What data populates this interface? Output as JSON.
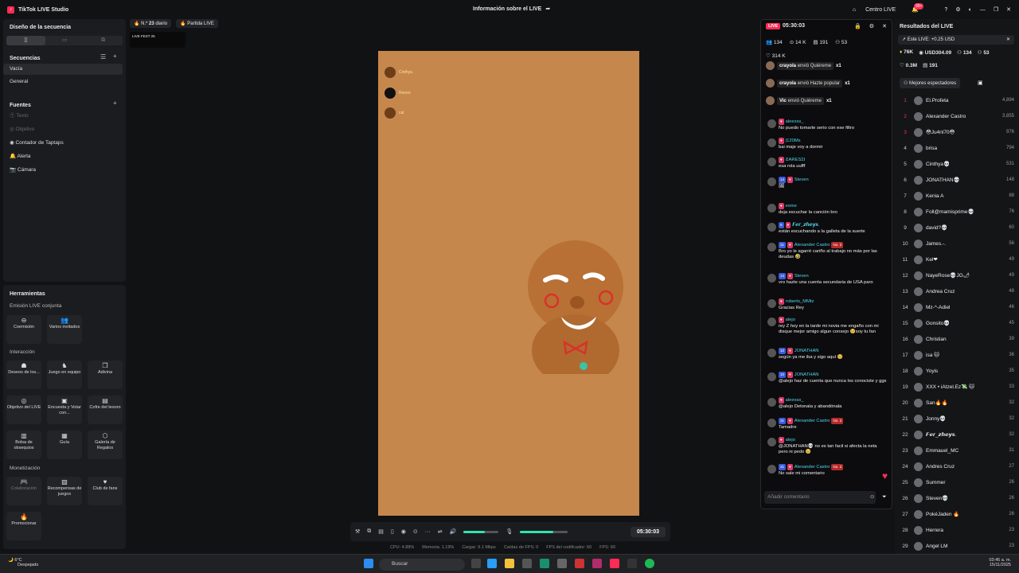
{
  "window": {
    "app_title": "TikTok LIVE Studio",
    "center_title": "Información sobre el LIVE",
    "centro_live": "Centro LIVE",
    "notif_badge": "99+"
  },
  "left": {
    "design_title": "Diseño de la secuencia",
    "sequences_title": "Secuencias",
    "sequences": [
      "Vacía",
      "General"
    ],
    "sources_title": "Fuentes",
    "sources": [
      "Texto",
      "Objetivo",
      "Contador de Taptaps",
      "Alerta",
      "Cámara"
    ],
    "tools_title": "Herramientas",
    "groups": {
      "joint": "Emisión LIVE conjunta",
      "interaction": "Interacción",
      "monetization": "Monetización"
    },
    "tools_joint": [
      "Coemisión",
      "Varios invitados"
    ],
    "tools_interaction": [
      "Deseos de los...",
      "Juego en equipo",
      "Adivina",
      "Objetivo del LIVE",
      "Encuesta y Votar con...",
      "Cofre del tesoro",
      "Bolsa de obsequios",
      "Guía",
      "Galería de Regalos"
    ],
    "tools_monet": [
      "Colaboración",
      "Recompensas de juegos",
      "Club de fans",
      "Promocionar"
    ]
  },
  "preview": {
    "rank_pill": "N.º",
    "rank_num": "23",
    "rank_suffix": "diario",
    "match_pill": "Partida LIVE",
    "livefest": "LIVE FEST 25",
    "gifts": [
      {
        "name": "Cinthya"
      },
      {
        "name": "Renee"
      },
      {
        "name": "cal"
      }
    ]
  },
  "controls": {
    "timer": "05:30:03",
    "volume": 0.6,
    "mic": 0.7
  },
  "status": {
    "cpu": "CPU: 4.88%",
    "mem": "Memoria: 1.19%",
    "load": "Cargar: 9.1 Mbps",
    "drops": "Caídas de FPS: 0",
    "enc": "FPS del codificador: 60",
    "fps": "FPS: 60"
  },
  "chat": {
    "live": "LIVE",
    "time": "05:30:03",
    "viewers": "134",
    "k": "14 K",
    "c1": "191",
    "c2": "53",
    "likes": "314 K",
    "pinned": [
      {
        "user": "crayola",
        "action": "envió Quiéreme",
        "count": "x1"
      },
      {
        "user": "crayola",
        "action": "envió Hazte popular",
        "count": "x1"
      },
      {
        "user": "Vic",
        "action": "envió Quiéreme",
        "count": "x1"
      }
    ],
    "messages": [
      {
        "name": "aleexss_",
        "text": "No puedo tomarte serio con ese filtro"
      },
      {
        "name": "|120Ms",
        "text": "bai maje voy a dormir"
      },
      {
        "name": "ƧARESΣI",
        "text": "esa rola uufff"
      },
      {
        "lvl": "14",
        "name": "Steven",
        "text": "🖼"
      },
      {
        "name": "esme",
        "text": "deja escuchar la canción bro"
      },
      {
        "lvl": "9",
        "name": "𝙁𝙚𝙧_𝙯𝙝𝙚𝙮𝙨.",
        "text": "están escuchando a la galleta de la suerte"
      },
      {
        "lvl": "31",
        "name": "Alexander Castro",
        "no2": "No. 2",
        "text": "Bro yo le agarré cariño al trabajo no más por las deudas 🤣"
      },
      {
        "lvl": "14",
        "name": "Steven",
        "text": "vro hazte una cuenta secundaria de USA paro"
      },
      {
        "name": "roberto_MMtz",
        "text": "Gracias Rey"
      },
      {
        "name": "alejo",
        "text": "rey Z hoy en la tarde mi novia me engaño con mi disque mejor amigo algun consejo 🥺soy tu fan"
      },
      {
        "lvl": "10",
        "name": "JONATHAN",
        "text": "según ya me iba y sigo aquí 🥺"
      },
      {
        "lvl": "10",
        "name": "JONATHAN",
        "text": "@alejo haz de cuenta que nunca los conociste y ggs"
      },
      {
        "name": "aleexss_",
        "text": "@alejo Detonala y abandónala"
      },
      {
        "lvl": "31",
        "name": "Alexander Castro",
        "no2": "No. 2",
        "text": "Tamadre"
      },
      {
        "name": "alejo",
        "text": "@JONATHAN💀 no es tan facil si afecta la neta pero ni pedo 🥺"
      },
      {
        "lvl": "31",
        "name": "Alexander Castro",
        "no2": "No. 2",
        "text": "No sale mi comentario"
      }
    ],
    "input_placeholder": "Añadir comentario"
  },
  "results": {
    "title": "Resultados del LIVE",
    "estimate": "Este LIVE: +0.25 USD",
    "s1": "76K",
    "s2": "USD304.09",
    "s3": "134",
    "s4": "53",
    "s5": "0.3M",
    "s6": "191",
    "tab": "Mejores espectadores",
    "ranking": [
      {
        "n": "1",
        "name": "El.Profeta",
        "score": "4,894"
      },
      {
        "n": "2",
        "name": "Alexander Castro",
        "score": "3,855"
      },
      {
        "n": "3",
        "name": "😳Ju4nl70😳",
        "score": "976"
      },
      {
        "n": "4",
        "name": "brisa",
        "score": "794"
      },
      {
        "n": "5",
        "name": "Cinthya💀",
        "score": "531"
      },
      {
        "n": "6",
        "name": "JONATHAN💀",
        "score": "148"
      },
      {
        "n": "7",
        "name": "Kenia A",
        "score": "88"
      },
      {
        "n": "8",
        "name": "Foll@mamisprime💀",
        "score": "76"
      },
      {
        "n": "9",
        "name": "david?💀",
        "score": "60"
      },
      {
        "n": "10",
        "name": "James.-.",
        "score": "56"
      },
      {
        "n": "11",
        "name": "Kel❤",
        "score": "49"
      },
      {
        "n": "12",
        "name": "NayeRose💀JG🌶",
        "score": "49"
      },
      {
        "n": "13",
        "name": "Andrea Cruz",
        "score": "48"
      },
      {
        "n": "14",
        "name": "Mz-^-Adiel",
        "score": "46"
      },
      {
        "n": "15",
        "name": "Gonsito💀",
        "score": "45"
      },
      {
        "n": "16",
        "name": "Christian",
        "score": "39"
      },
      {
        "n": "17",
        "name": "isa 🐱",
        "score": "36"
      },
      {
        "n": "18",
        "name": "Yoyis",
        "score": "35"
      },
      {
        "n": "19",
        "name": "XXX • iAtzel.Ez💸 🐱",
        "score": "33"
      },
      {
        "n": "20",
        "name": "San🔥🔥",
        "score": "32"
      },
      {
        "n": "21",
        "name": "Jonny💀",
        "score": "32"
      },
      {
        "n": "22",
        "name": "𝙁𝙚𝙧_𝙯𝙝𝙚𝙮𝙨.",
        "score": "32"
      },
      {
        "n": "23",
        "name": "Emmauel_MC",
        "score": "31"
      },
      {
        "n": "24",
        "name": "Andres Cruz",
        "score": "27"
      },
      {
        "n": "25",
        "name": "Summer",
        "score": "26"
      },
      {
        "n": "26",
        "name": "Steven💀",
        "score": "26"
      },
      {
        "n": "27",
        "name": "PokéJaden 🔥",
        "score": "26"
      },
      {
        "n": "28",
        "name": "Herrera",
        "score": "23"
      },
      {
        "n": "29",
        "name": "Angel LM",
        "score": "23"
      }
    ]
  },
  "taskbar": {
    "temp": "6°C",
    "weather": "Despejado",
    "search": "Buscar",
    "time": "03:45 a. m.",
    "date": "15/11/2025"
  }
}
